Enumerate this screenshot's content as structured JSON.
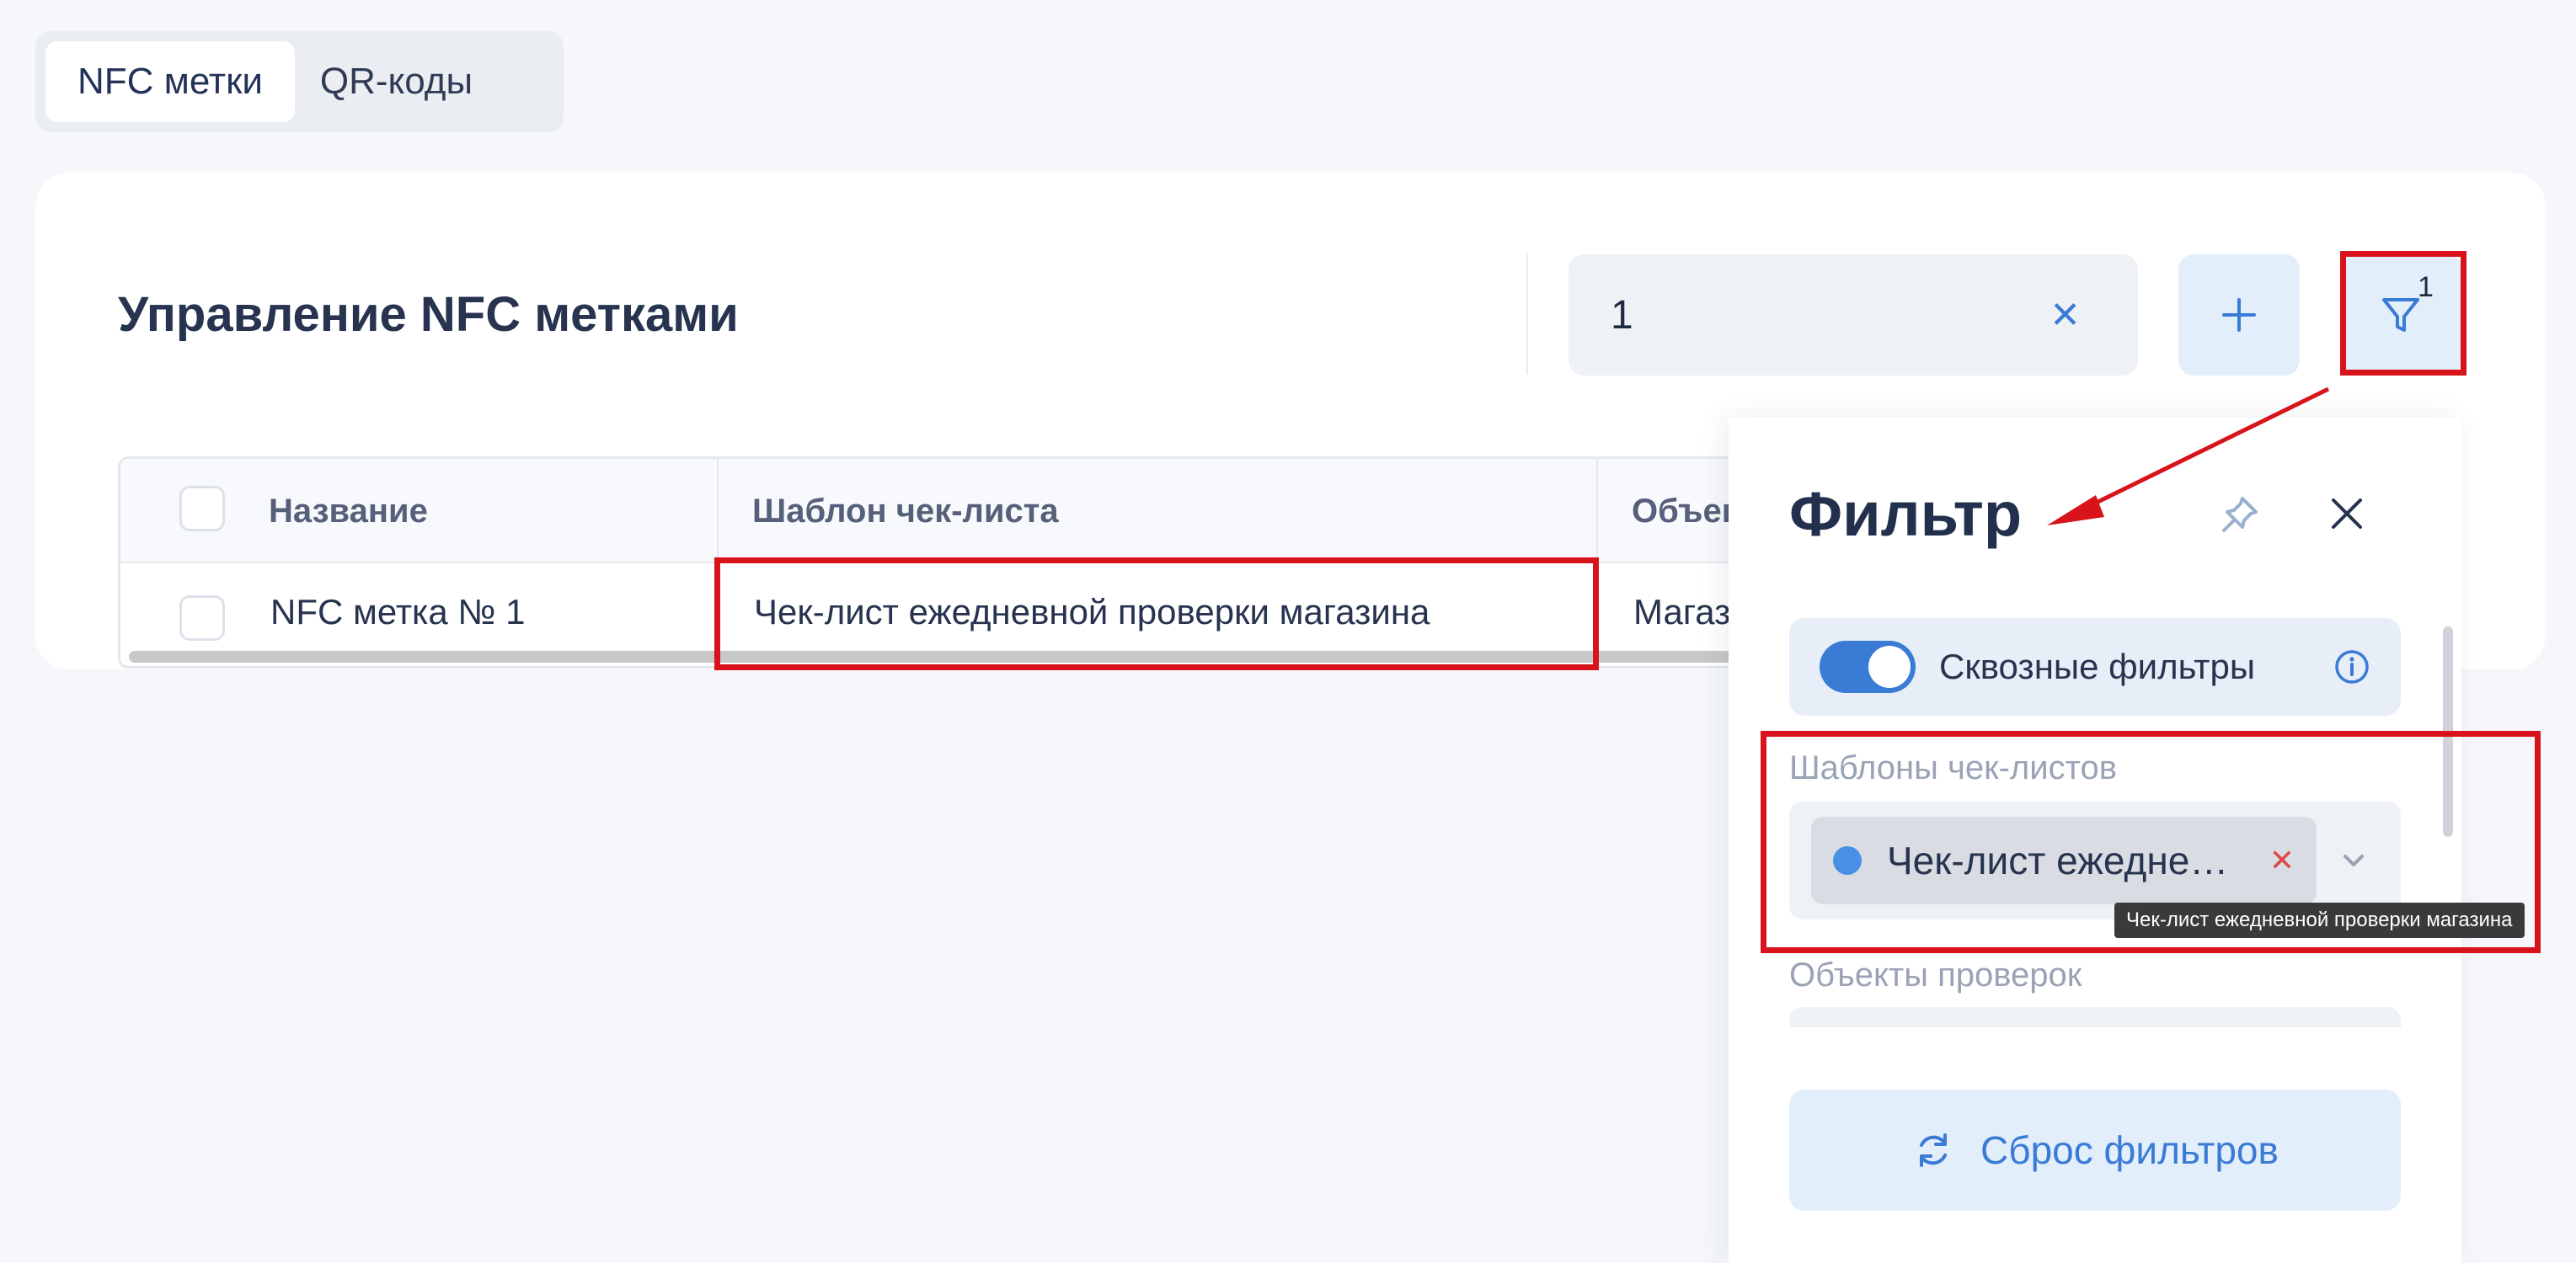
{
  "tabs": [
    {
      "label": "NFC метки",
      "active": true
    },
    {
      "label": "QR-коды",
      "active": false
    }
  ],
  "header": {
    "title": "Управление NFC метками",
    "search_value": "1",
    "filter_count": "1"
  },
  "table": {
    "columns": [
      "Название",
      "Шаблон чек-листа",
      "Объек"
    ],
    "rows": [
      {
        "name": "NFC метка № 1",
        "template": "Чек-лист ежедневной проверки магазина",
        "object": "Магаз"
      }
    ]
  },
  "filter_panel": {
    "title": "Фильтр",
    "toggle_label": "Сквозные фильтры",
    "toggle_on": true,
    "templates_label": "Шаблоны чек-листов",
    "template_chip": "Чек-лист ежедне…",
    "tooltip": "Чек-лист ежедневной проверки магазина",
    "objects_label": "Объекты проверок",
    "reset_label": "Сброс фильтров"
  },
  "colors": {
    "accent": "#3a7bd5",
    "annotation_red": "#d8131b",
    "chip_dot": "#4a8fe6"
  },
  "icons": [
    "close-icon",
    "plus-icon",
    "filter-funnel-icon",
    "pin-icon",
    "info-icon",
    "chevron-down-icon",
    "refresh-icon"
  ]
}
